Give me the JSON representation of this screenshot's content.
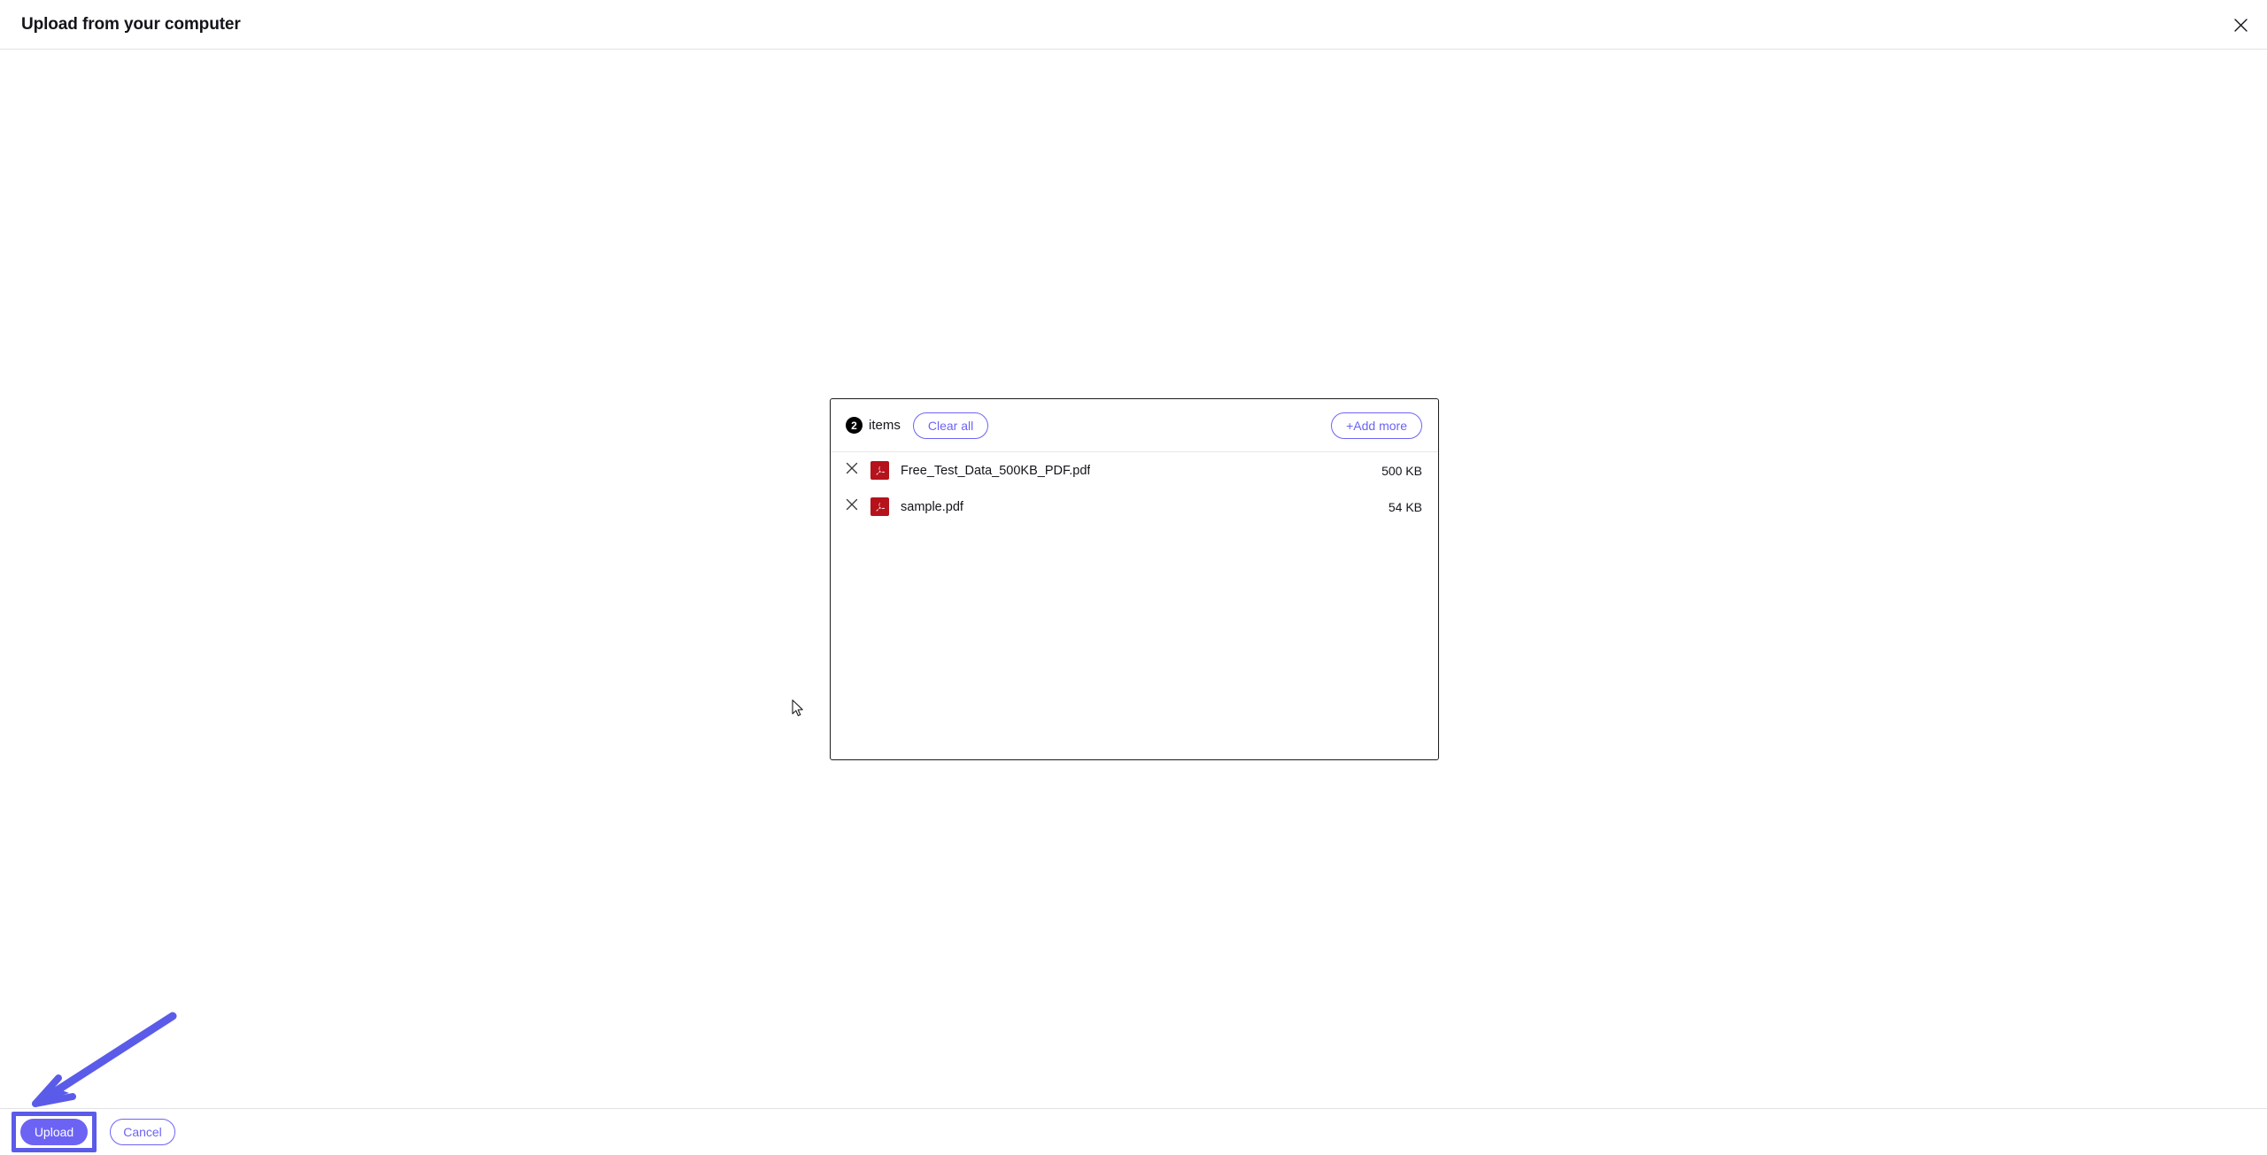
{
  "header": {
    "title": "Upload from your computer",
    "close_icon": "close-icon"
  },
  "panel": {
    "count": "2",
    "items_label": "items",
    "clear_all_label": "Clear all",
    "add_more_label": "+Add more",
    "files": [
      {
        "name": "Free_Test_Data_500KB_PDF.pdf",
        "size": "500 KB",
        "type_icon": "pdf-file-icon",
        "remove_icon": "close-icon"
      },
      {
        "name": "sample.pdf",
        "size": "54 KB",
        "type_icon": "pdf-file-icon",
        "remove_icon": "close-icon"
      }
    ]
  },
  "footer": {
    "upload_label": "Upload",
    "cancel_label": "Cancel"
  },
  "annotations": {
    "arrow": "arrow-pointing-to-upload-button",
    "highlight": "upload-button-highlight-box"
  },
  "colors": {
    "accent_purple": "#6c63f5",
    "highlight_purple": "#5b5bea",
    "pdf_red": "#b5121b",
    "badge_black": "#000000",
    "text_primary": "#14151a",
    "border_light": "#e2e2e4",
    "panel_border": "#1b1b1b"
  }
}
